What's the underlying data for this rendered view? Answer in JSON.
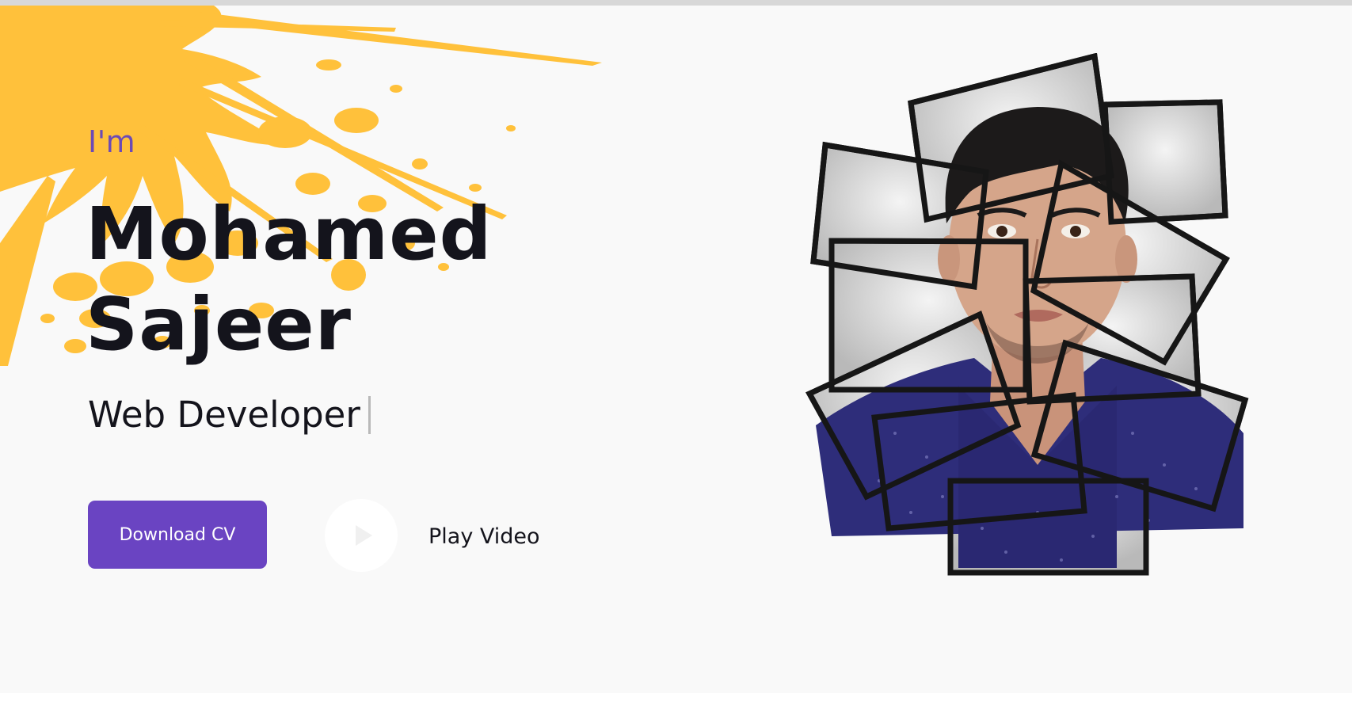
{
  "hero": {
    "intro": "I'm",
    "name_line1": "Mohamed",
    "name_line2": "Sajeer",
    "role": "Web Developer",
    "download_label": "Download CV",
    "play_label": "Play Video"
  },
  "icons": {
    "play": "play-icon"
  },
  "colors": {
    "accent": "#6a44c2",
    "splash": "#ffc13b",
    "text": "#14141c",
    "background": "#f9f9f9",
    "shirt": "#2e2d7a"
  }
}
